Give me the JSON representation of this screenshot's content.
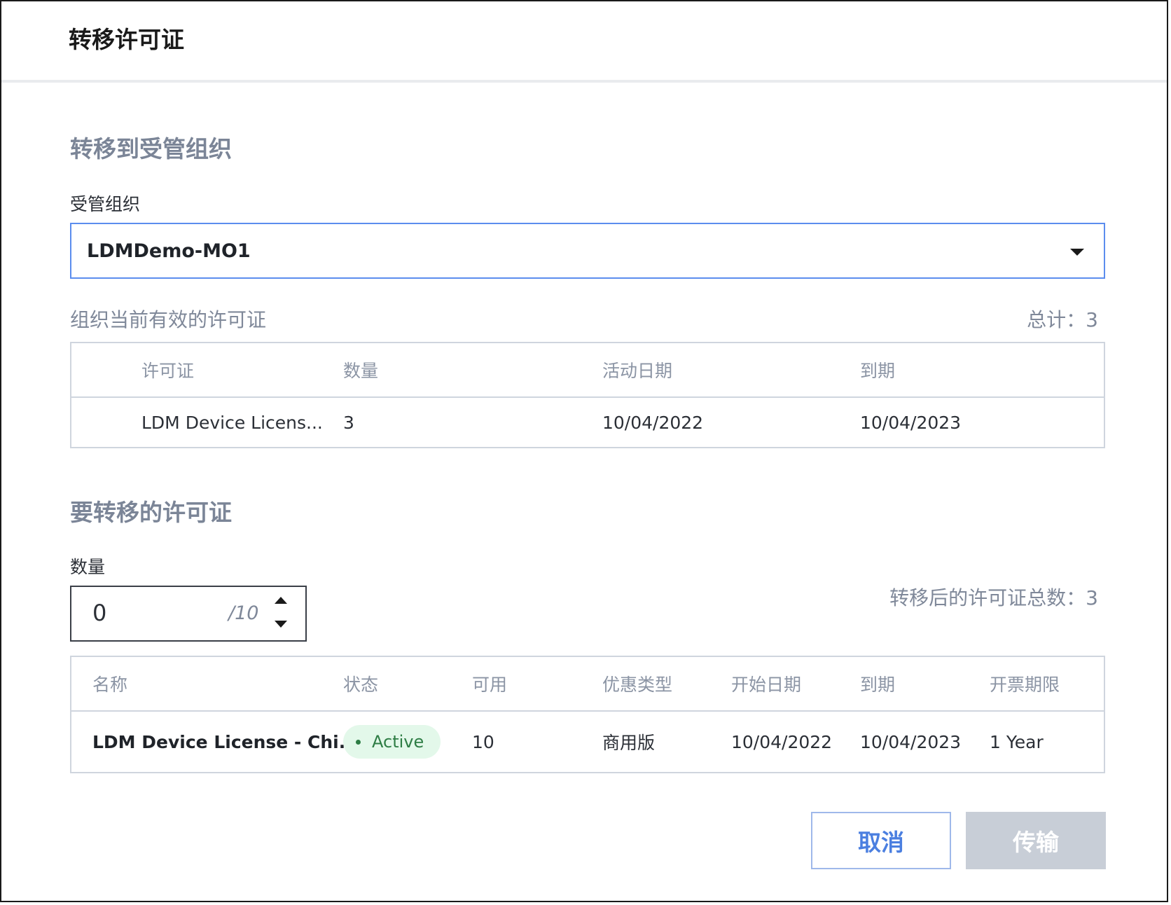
{
  "dialog": {
    "title": "转移许可证"
  },
  "section_org": {
    "title": "转移到受管组织",
    "field_label": "受管组织",
    "selected_org": "LDMDemo-MO1",
    "current_licenses_label": "组织当前有效的许可证",
    "total_label": "总计：3",
    "table": {
      "headers": [
        "许可证",
        "数量",
        "活动日期",
        "到期"
      ],
      "rows": [
        [
          "LDM Device Licens...",
          "3",
          "10/04/2022",
          "10/04/2023"
        ]
      ]
    }
  },
  "section_transfer": {
    "title": "要转移的许可证",
    "quantity_label": "数量",
    "quantity_value": "0",
    "quantity_max": "/10",
    "after_total_label": "转移后的许可证总数：3",
    "table": {
      "headers": [
        "名称",
        "状态",
        "可用",
        "优惠类型",
        "开始日期",
        "到期",
        "开票期限"
      ],
      "rows": [
        {
          "name": "LDM Device License - Chi...",
          "status": "Active",
          "available": "10",
          "offer_type": "商用版",
          "start_date": "10/04/2022",
          "expiry": "10/04/2023",
          "billing_term": "1 Year"
        }
      ]
    }
  },
  "buttons": {
    "cancel": "取消",
    "submit": "传输"
  },
  "colors": {
    "accent": "#5b8dee",
    "section_title": "#7b8597",
    "status_active_bg": "#e3f8ea",
    "status_active_text": "#2e7d45",
    "disabled_button": "#c8ced7"
  }
}
